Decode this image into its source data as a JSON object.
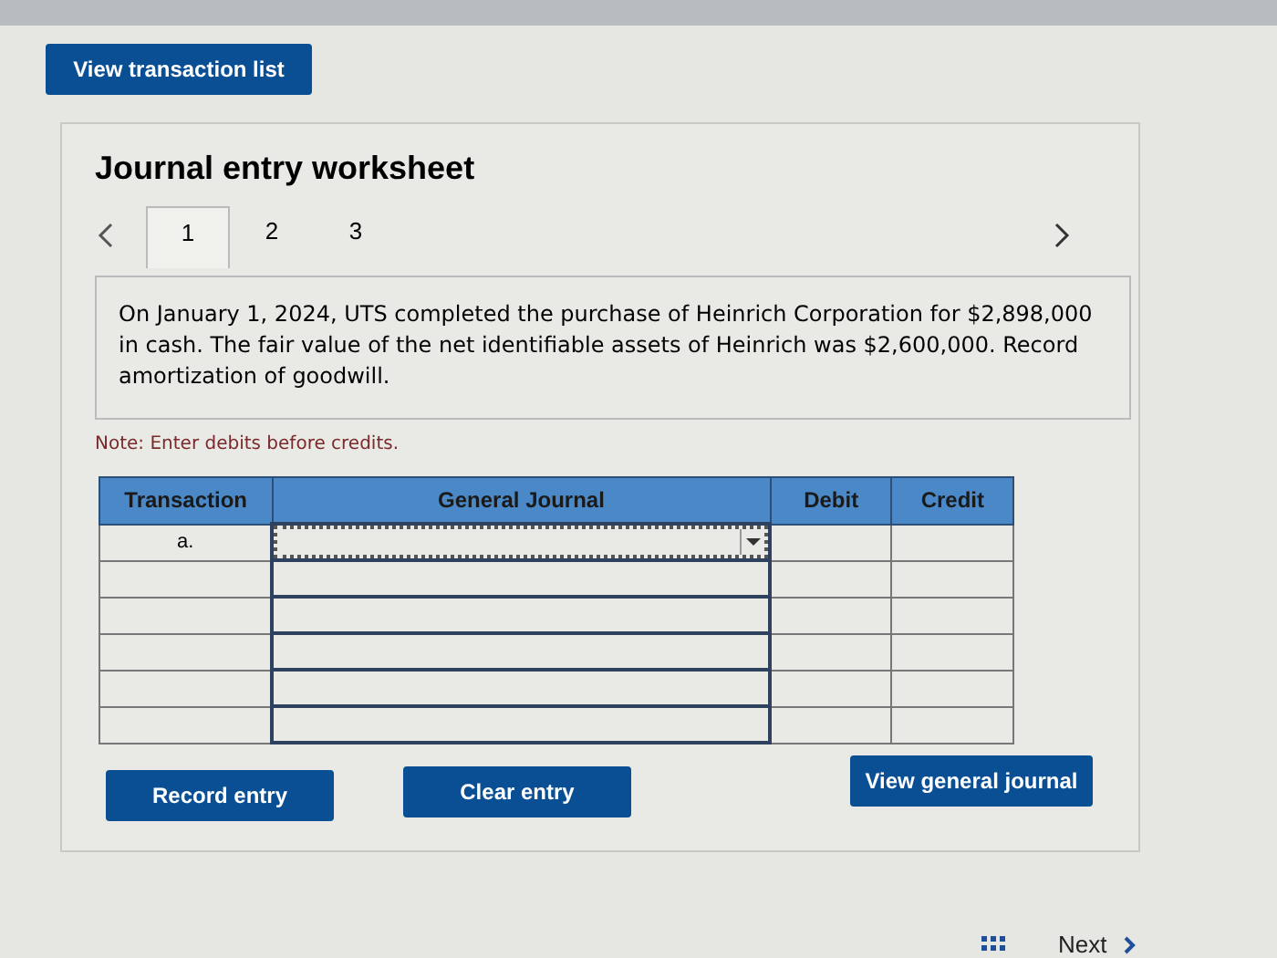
{
  "top_button": "View transaction list",
  "worksheet": {
    "title": "Journal entry worksheet",
    "tabs": [
      {
        "label": "1",
        "selected": true
      },
      {
        "label": "2",
        "selected": false
      },
      {
        "label": "3",
        "selected": false
      }
    ],
    "description": "On January 1, 2024, UTS completed the purchase of Heinrich Corporation for $2,898,000 in cash. The fair value of the net identifiable assets of Heinrich was $2,600,000. Record amortization of goodwill.",
    "note": "Note: Enter debits before credits.",
    "table": {
      "columns": [
        "Transaction",
        "General Journal",
        "Debit",
        "Credit"
      ],
      "rows": [
        {
          "transaction": "a.",
          "focused": true
        },
        {
          "focused": false
        },
        {
          "focused": false
        },
        {
          "focused": false
        },
        {
          "focused": false
        },
        {
          "focused": false
        }
      ]
    },
    "buttons": [
      "Record entry",
      "Clear entry",
      "View general journal"
    ]
  },
  "footer": {
    "next": "Next"
  }
}
